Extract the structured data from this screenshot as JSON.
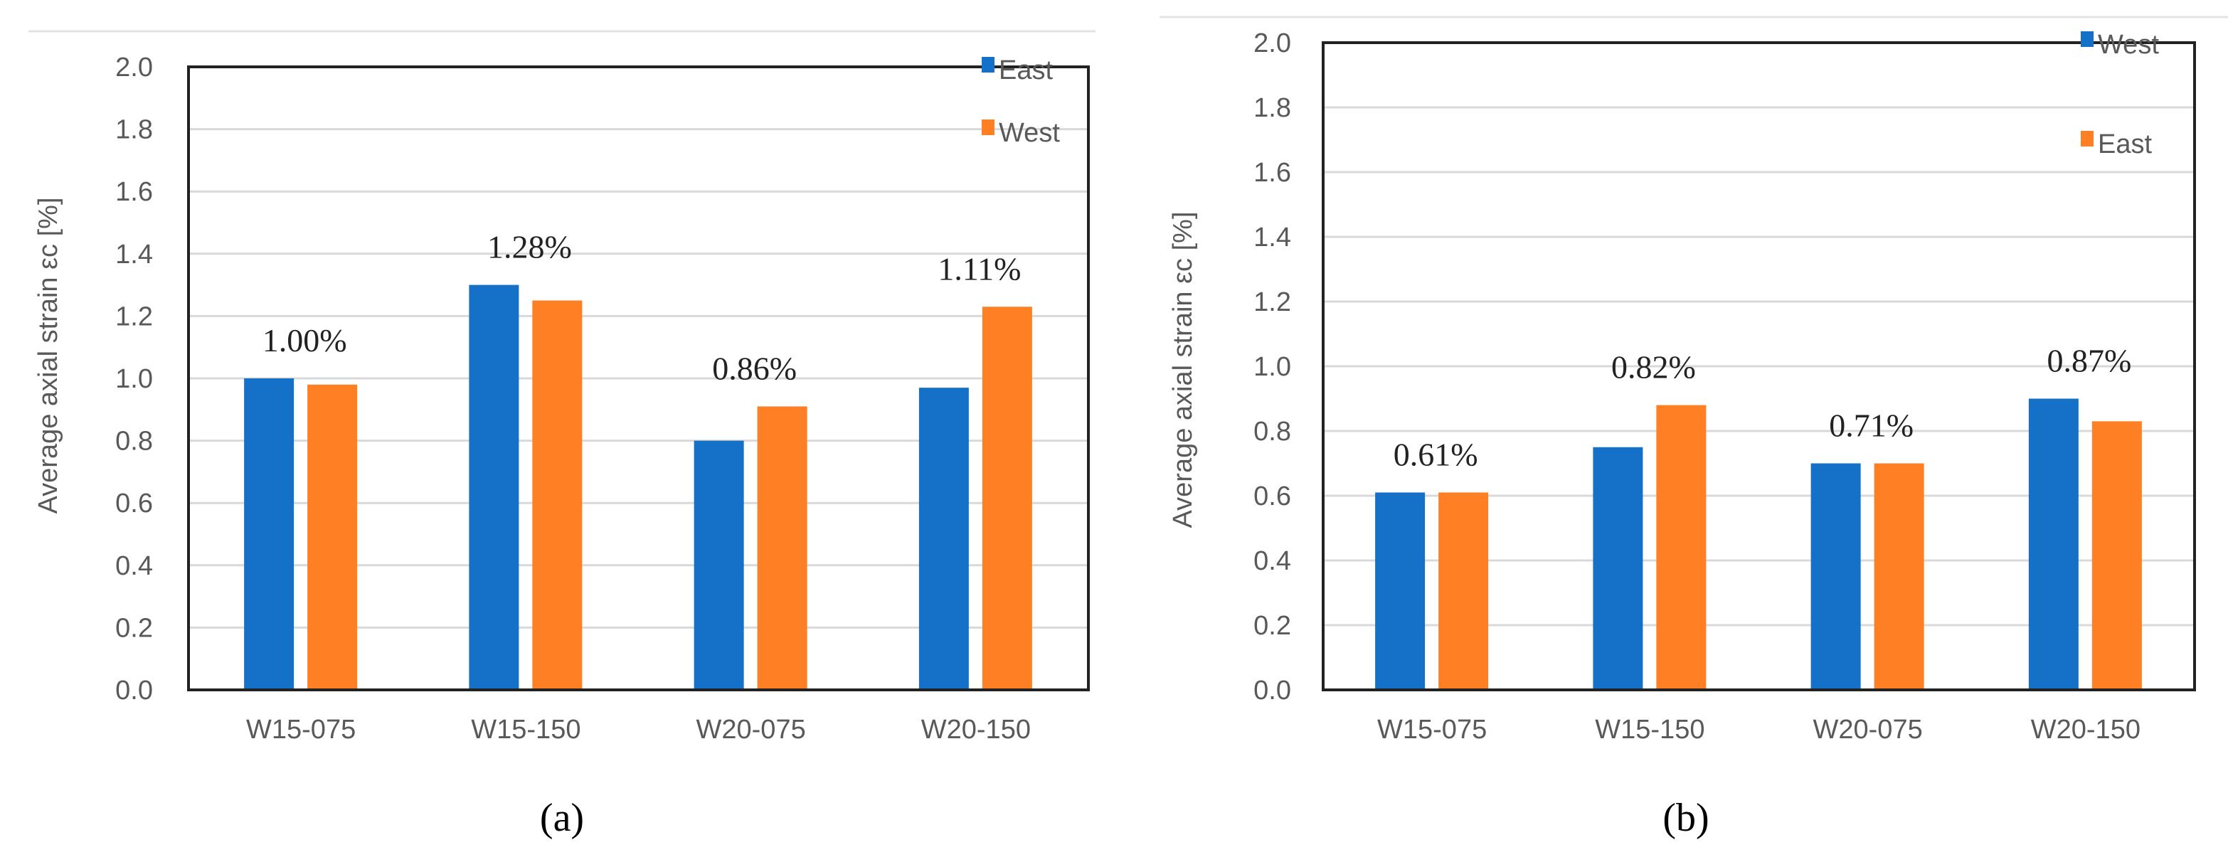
{
  "chart_data": [
    {
      "type": "bar",
      "panel_label": "(a)",
      "ylabel": "Average  axial strain εc  [%]",
      "ylim": [
        0,
        2.0
      ],
      "yticks": [
        "0.0",
        "0.2",
        "0.4",
        "0.6",
        "0.8",
        "1.0",
        "1.2",
        "1.4",
        "1.6",
        "1.8",
        "2.0"
      ],
      "grid": true,
      "legend": "top-right",
      "categories": [
        "W15-075",
        "W15-150",
        "W20-075",
        "W20-150"
      ],
      "series": [
        {
          "name": "East",
          "color": "#1570C8",
          "values": [
            1.0,
            1.3,
            0.8,
            0.97
          ]
        },
        {
          "name": "West",
          "color": "#FF7F24",
          "values": [
            0.98,
            1.25,
            0.91,
            1.23
          ]
        }
      ],
      "data_labels": [
        "1.00%",
        "1.28%",
        "0.86%",
        "1.11%"
      ]
    },
    {
      "type": "bar",
      "panel_label": "(b)",
      "ylabel": "Average  axial strain εc  [%]",
      "ylim": [
        0,
        2.0
      ],
      "yticks": [
        "0.0",
        "0.2",
        "0.4",
        "0.6",
        "0.8",
        "1.0",
        "1.2",
        "1.4",
        "1.6",
        "1.8",
        "2.0"
      ],
      "grid": true,
      "legend": "top-right",
      "categories": [
        "W15-075",
        "W15-150",
        "W20-075",
        "W20-150"
      ],
      "series": [
        {
          "name": "West",
          "color": "#1570C8",
          "values": [
            0.61,
            0.75,
            0.7,
            0.9
          ]
        },
        {
          "name": "East",
          "color": "#FF7F24",
          "values": [
            0.61,
            0.88,
            0.7,
            0.83
          ]
        }
      ],
      "data_labels": [
        "0.61%",
        "0.82%",
        "0.71%",
        "0.87%"
      ]
    }
  ]
}
